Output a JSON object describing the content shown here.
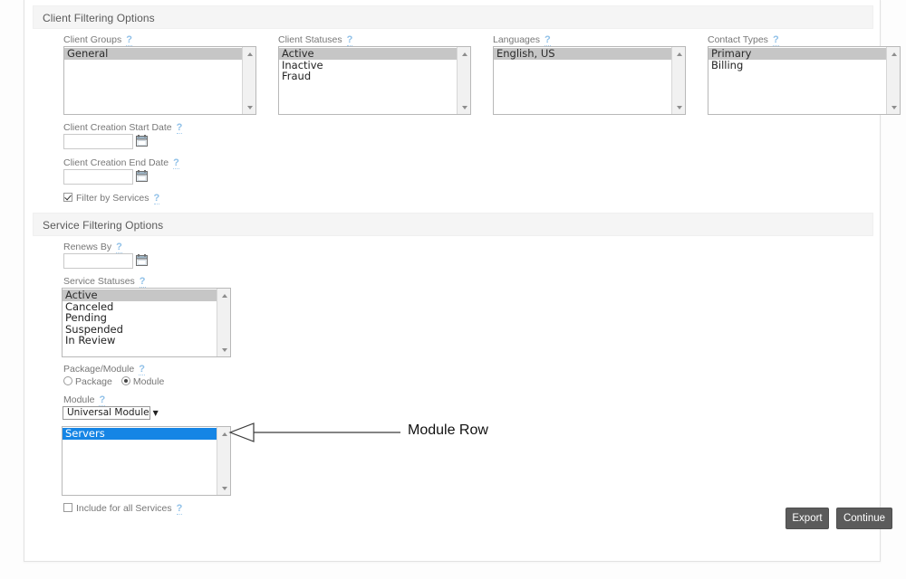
{
  "sections": {
    "client": {
      "title": "Client Filtering Options"
    },
    "service": {
      "title": "Service Filtering Options"
    }
  },
  "help_marker": "?",
  "client_filters": {
    "client_groups": {
      "label": "Client Groups",
      "options": [
        "General"
      ],
      "selected": "General"
    },
    "client_statuses": {
      "label": "Client Statuses",
      "options": [
        "Active",
        "Inactive",
        "Fraud"
      ],
      "selected": "Active"
    },
    "languages": {
      "label": "Languages",
      "options": [
        "English, US"
      ],
      "selected": "English, US"
    },
    "contact_types": {
      "label": "Contact Types",
      "options": [
        "Primary",
        "Billing"
      ],
      "selected": "Primary"
    },
    "creation_start_date": {
      "label": "Client Creation Start Date",
      "value": "",
      "placeholder": ""
    },
    "creation_end_date": {
      "label": "Client Creation End Date",
      "value": "",
      "placeholder": ""
    },
    "filter_by_services": {
      "label": "Filter by Services",
      "checked": true
    }
  },
  "service_filters": {
    "renews_by": {
      "label": "Renews By",
      "value": "",
      "placeholder": ""
    },
    "service_statuses": {
      "label": "Service Statuses",
      "options": [
        "Active",
        "Canceled",
        "Pending",
        "Suspended",
        "In Review"
      ],
      "selected": "Active"
    },
    "package_module": {
      "label": "Package/Module",
      "options": [
        "Package",
        "Module"
      ],
      "selected": "Module"
    },
    "module": {
      "label": "Module",
      "selected": "Universal Module",
      "caret": "▼"
    },
    "module_rows": {
      "options": [
        "Servers"
      ],
      "selected": "Servers"
    },
    "include_all_services": {
      "label": "Include for all Services",
      "checked": false
    }
  },
  "annotation": {
    "label": "Module Row"
  },
  "footer": {
    "export_label": "Export",
    "continue_label": "Continue"
  },
  "colors": {
    "section_header_bg": "#f5f5f5",
    "selection_gray": "#c6c6c6",
    "selection_blue": "#1585e5",
    "button_bg": "#5b5b5b",
    "help_link": "#8fc0e8"
  }
}
